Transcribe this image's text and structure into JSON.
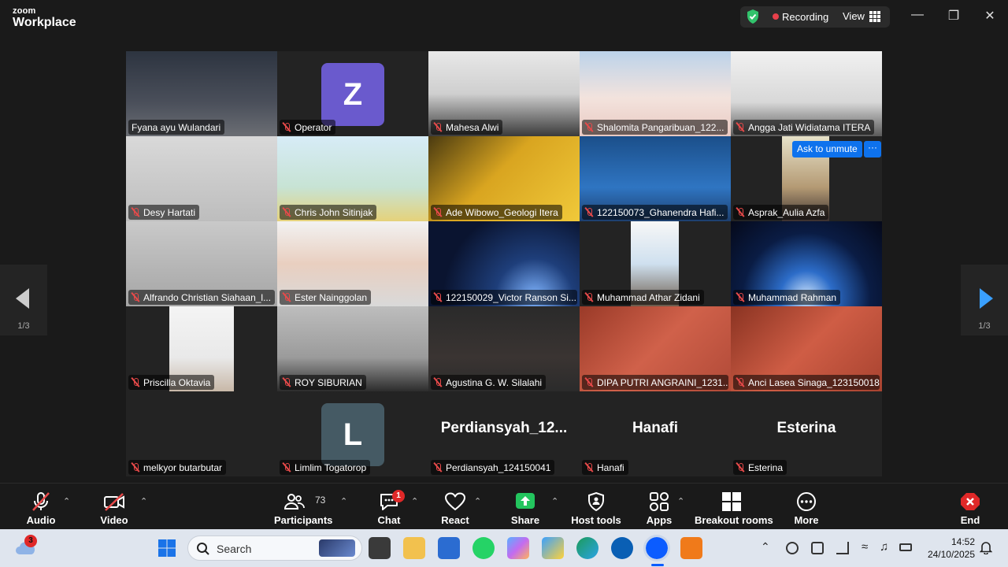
{
  "app": {
    "brand_top": "zoom",
    "brand_bottom": "Workplace"
  },
  "header": {
    "recording_label": "Recording",
    "view_label": "View"
  },
  "pager": {
    "left": "1/3",
    "right": "1/3"
  },
  "participants": [
    {
      "name": "Fyana ayu Wulandari",
      "muted": false
    },
    {
      "name": "Operator",
      "muted": true,
      "avatar_letter": "Z",
      "avatar_color": "#6a5acd"
    },
    {
      "name": "Mahesa Alwi",
      "muted": true
    },
    {
      "name": "Shalomita Pangaribuan_122...",
      "muted": true
    },
    {
      "name": "Angga Jati Widiatama ITERA",
      "muted": true
    },
    {
      "name": "Desy Hartati",
      "muted": true
    },
    {
      "name": "Chris John Sitinjak",
      "muted": true
    },
    {
      "name": "Ade Wibowo_Geologi Itera",
      "muted": true
    },
    {
      "name": "122150073_Ghanendra Hafi...",
      "muted": true
    },
    {
      "name": "Asprak_Aulia Azfa",
      "muted": true
    },
    {
      "name": "Alfrando Christian Siahaan_l...",
      "muted": true
    },
    {
      "name": "Ester Nainggolan",
      "muted": true
    },
    {
      "name": "122150029_Victor Ranson Si...",
      "muted": true
    },
    {
      "name": "Muhammad Athar Zidani",
      "muted": true
    },
    {
      "name": "Muhammad Rahman",
      "muted": true
    },
    {
      "name": "Priscilla Oktavia",
      "muted": true
    },
    {
      "name": "ROY SIBURIAN",
      "muted": true
    },
    {
      "name": "Agustina G. W. Silalahi",
      "muted": true
    },
    {
      "name": "DIPA PUTRI ANGRAINI_1231...",
      "muted": true
    },
    {
      "name": "Anci Lasea Sinaga_123150018",
      "muted": true
    },
    {
      "name": "melkyor butarbutar",
      "muted": true
    },
    {
      "name": "Limlim Togatorop",
      "muted": true,
      "avatar_letter": "L",
      "avatar_color": "#455a64"
    },
    {
      "name": "Perdiansyah_124150041",
      "muted": true,
      "big_name": "Perdiansyah_12..."
    },
    {
      "name": "Hanafi",
      "muted": true,
      "big_name": "Hanafi"
    },
    {
      "name": "Esterina",
      "muted": true,
      "big_name": "Esterina"
    }
  ],
  "overlay": {
    "ask_unmute": "Ask to unmute",
    "more": "···"
  },
  "toolbar": {
    "audio": "Audio",
    "video": "Video",
    "participants": "Participants",
    "participants_count": "73",
    "chat": "Chat",
    "chat_badge": "1",
    "react": "React",
    "share": "Share",
    "host_tools": "Host tools",
    "apps": "Apps",
    "breakout": "Breakout rooms",
    "more": "More",
    "end": "End"
  },
  "taskbar": {
    "weather_badge": "3",
    "search_placeholder": "Search",
    "time": "14:52",
    "date": "24/10/2025"
  },
  "colors": {
    "accent": "#0e72ed",
    "active_speaker": "#32c36c",
    "share_green": "#23c55e",
    "end_red": "#e02828"
  }
}
